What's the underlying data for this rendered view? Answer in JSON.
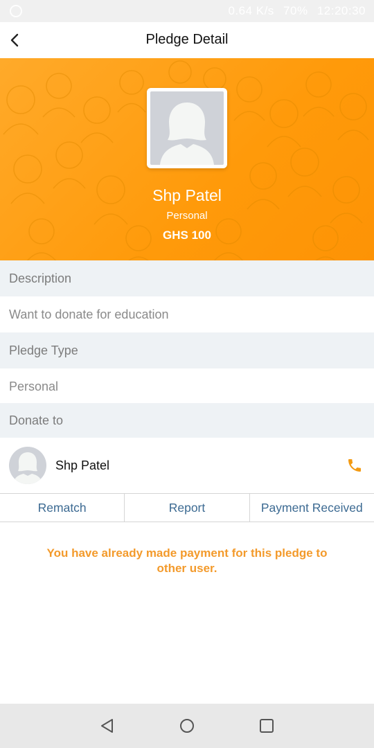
{
  "status_bar": {
    "speed": "0.64 K/s",
    "battery": "70%",
    "time": "12:20:30"
  },
  "app_bar": {
    "title": "Pledge Detail",
    "back_icon": "chevron-left-icon"
  },
  "profile": {
    "name": "Shp Patel",
    "pledge_type": "Personal",
    "amount": "GHS 100",
    "accent_color": "#ff9f12"
  },
  "details": {
    "description_label": "Description",
    "description_value": "Want to donate for education",
    "pledge_type_label": "Pledge Type",
    "pledge_type_value": "Personal",
    "donate_to_label": "Donate to"
  },
  "recipient": {
    "name": "Shp Patel",
    "call_icon": "phone-icon"
  },
  "actions": {
    "rematch": "Rematch",
    "report": "Report",
    "payment_received": "Payment Received"
  },
  "notice": "You have already made payment for this pledge to other user.",
  "colors": {
    "action_text": "#3c6a92",
    "notice_text": "#f39a2b",
    "label_bg": "#eef2f5"
  }
}
